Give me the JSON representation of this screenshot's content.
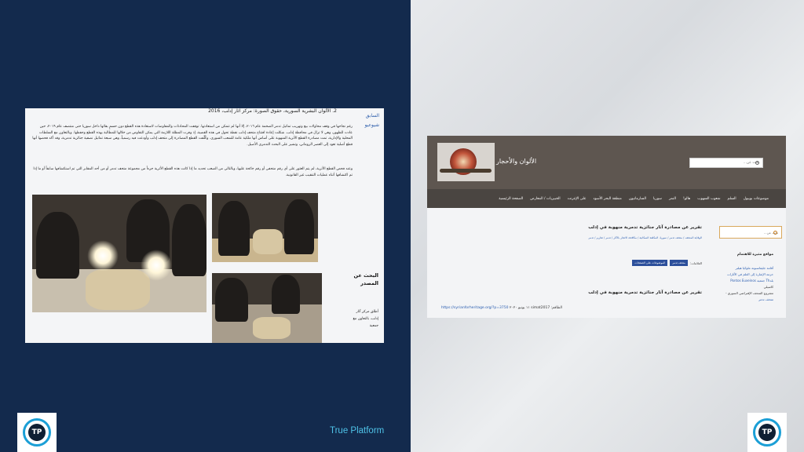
{
  "left_shot": {
    "top_line": "2. الألوان البشرية السورية، حقوق الصورة: مركز آثار إدلب، 2016",
    "side_links": [
      "السابق",
      "شيوعيو"
    ],
    "paragraph1": "رغم نجاحها في وقف محاولات بيع وتهريب تماثيل تدمر الضخمة عام ٢٠١٦، إلا أنها لم تتمكن من استعادتها. توقفت المحادثات والمفاوضات لاستعادة هذه القطع دون حسمٍ بقائها داخل سوريا حتى منتصف عام ٢٠١٩، حين عادت للظهور، وهي لا تزال في محافظة إدلب. شكلت إعادة افتتاح متحف إدلب نقطة تحول في هذه القضية، إذ وفرت المظلة اللازمة التي يمكن التفاوض من خلالها للمطالبة بهذه القطع وحفظها. وبالتعاون مع السلطات المحلية والإدارية، تمت مصادرة القطع الأثرية المنهوبة على أساس أنها ملكية عامة للشعب السوري. وكُلّفت القطع المصادرة إلى متحف إدلب وأودعت فيه رسمياً، وهي سبعة تماثيل نصفية جنائزية تدمرية، وقد أكد فحصها أنها قطع أصلية تعود إلى العصر الروماني، وتشير على البحث التدمري الأصيل.",
    "paragraph2": "وعند فحص القطع الأثرية، لم يتم العثور على أي رقم متحفي أو رقم جائحة عليها، وبالتالي من الصعب تحديد ما إذا كانت هذه القطع الأثرية جزءاً من مجموعة متحف تدمر أو من أحد المقابر التي تم استكشافها سابقاً أو ما إذا تم اكتشافها أثناء عمليات التنقيب غير القانونية.",
    "section_heading": "البحث عن المصدر",
    "section_sub": "أطلق مركز آثار إدلب، بالتعاون مع جمعية"
  },
  "brand": {
    "text": "True Platform",
    "logo_letters": "TP",
    "accent": "#4fc3e8"
  },
  "right_shot": {
    "site_name": "الألوان والأحجار",
    "search_placeholder": "بحث عن...",
    "nav_items": [
      "موضوعات بوبيول",
      "السلم",
      "شعوب السهوب",
      "هالو!",
      "النمر",
      "سوريا",
      "السارماتيون",
      "منطقة البحر الأسود",
      "على الإنترنت",
      "الخبيريات / المعارض",
      "الصفحة الرئيسية"
    ],
    "post_title": "تقرير عن مصادرة آثار جنائزية تدمرية منهوبة في إدلب",
    "breadcrumbs": "الوقاية المتحف / متحف تدمر / سوريا، المكلفة السكانية / مكافحة الاتجار بالآثار / تدمر / تقارير / تدمر",
    "tags_label": "العلامات:",
    "tags": [
      "متحف تدمر",
      "الموضوعات على الصفحات"
    ],
    "post_title2": "تقرير عن مصادرة آثار جنائزية تدمرية منهوبة في إدلب",
    "post_meta_date": "١١ يونيو ٢٠٢٠",
    "post_meta_link": "https://syrianforheritage.org/?p=3750",
    "post_meta_author": "الطاقم: simat2017",
    "side_search_placeholder": "بحث عن...",
    "side_heading": "مواقع مثيرة للاهتمام",
    "side_links": [
      "أقامة جليفاسبوتة ملوكيا هيلبر",
      "حزمة الإشارة إلى العلم في الآثارات",
      "بلدTh جمعية Pontos Euxeinos",
      "كاسيلي",
      "مشروع المتحف الإفتراضي السوري -",
      "متحف تدمر"
    ]
  }
}
